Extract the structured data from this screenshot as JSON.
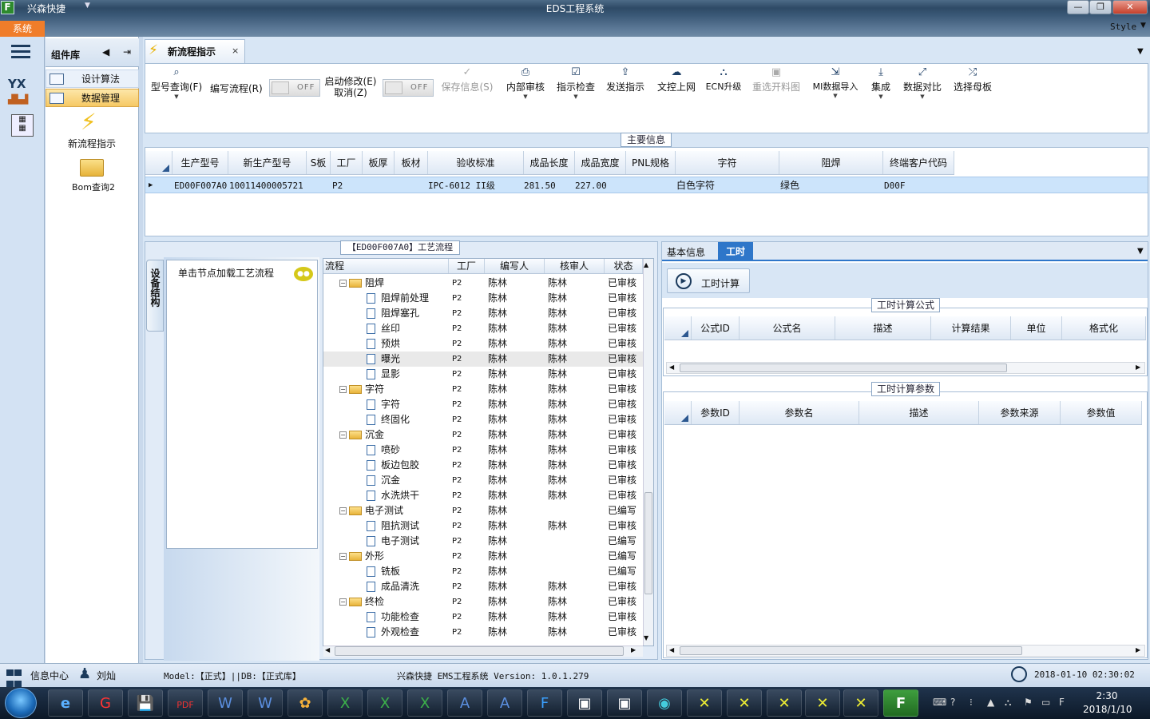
{
  "window": {
    "quick_title": "兴森快捷",
    "title": "EDS工程系统",
    "buttons": {
      "minimize": "—",
      "restore": "❐",
      "close": "✕"
    }
  },
  "ribbon": {
    "system_tab": "系统",
    "style_label": "Style"
  },
  "component_panel": {
    "title": "组件库",
    "items": [
      {
        "label": "设计算法",
        "icon": "form-icon"
      },
      {
        "label": "数据管理",
        "icon": "form-icon",
        "selected": true
      }
    ],
    "shortcuts": [
      {
        "label": "新流程指示",
        "icon": "lightning-icon"
      },
      {
        "label": "Bom查询2",
        "icon": "folder-icon"
      }
    ]
  },
  "doc_tab": {
    "label": "新流程指示",
    "close": "×"
  },
  "toolbar": {
    "query": "型号查询(F)",
    "write_flow": "编写流程(R)",
    "write_flow_toggle": "OFF",
    "start_modify": "启动修改(E)",
    "cancel": "取消(Z)",
    "start_modify_toggle": "OFF",
    "save": "保存信息(S)",
    "internal_review": "内部审核",
    "instruction_check": "指示检查",
    "send_instruction": "发送指示",
    "upload": "文控上网",
    "ecn_upgrade": "ECN升级",
    "reselect_cutting": "重选开料图",
    "mi_import": "MI数据导入",
    "integrate": "集成",
    "compare": "数据对比",
    "select_master": "选择母板"
  },
  "main_info": {
    "title": "主要信息",
    "columns": [
      "生产型号",
      "新生产型号",
      "S板",
      "工厂",
      "板厚",
      "板材",
      "验收标准",
      "成品长度",
      "成品宽度",
      "PNL规格",
      "字符",
      "阻焊",
      "终端客户代码"
    ],
    "row": [
      "ED00F007A0",
      "10011400005721",
      "",
      "P2",
      "",
      "",
      "IPC-6012 II级",
      "281.50",
      "227.00",
      "",
      "白色字符",
      "绿色",
      "D00F"
    ]
  },
  "process": {
    "title": "【ED00F007A0】工艺流程",
    "side_tab": "设备结构",
    "hint": "单击节点加载工艺流程",
    "columns": [
      "流程",
      "工厂",
      "编写人",
      "核审人",
      "状态"
    ],
    "rows": [
      {
        "name": "阻焊",
        "level": 0,
        "factory": "P2",
        "writer": "陈林",
        "reviewer": "陈林",
        "status": "已审核"
      },
      {
        "name": "阻焊前处理",
        "level": 1,
        "factory": "P2",
        "writer": "陈林",
        "reviewer": "陈林",
        "status": "已审核"
      },
      {
        "name": "阻焊塞孔",
        "level": 1,
        "factory": "P2",
        "writer": "陈林",
        "reviewer": "陈林",
        "status": "已审核"
      },
      {
        "name": "丝印",
        "level": 1,
        "factory": "P2",
        "writer": "陈林",
        "reviewer": "陈林",
        "status": "已审核"
      },
      {
        "name": "预烘",
        "level": 1,
        "factory": "P2",
        "writer": "陈林",
        "reviewer": "陈林",
        "status": "已审核"
      },
      {
        "name": "曝光",
        "level": 1,
        "factory": "P2",
        "writer": "陈林",
        "reviewer": "陈林",
        "status": "已审核",
        "highlight": true
      },
      {
        "name": "显影",
        "level": 1,
        "factory": "P2",
        "writer": "陈林",
        "reviewer": "陈林",
        "status": "已审核"
      },
      {
        "name": "字符",
        "level": 0,
        "factory": "P2",
        "writer": "陈林",
        "reviewer": "陈林",
        "status": "已审核"
      },
      {
        "name": "字符",
        "level": 1,
        "factory": "P2",
        "writer": "陈林",
        "reviewer": "陈林",
        "status": "已审核"
      },
      {
        "name": "终固化",
        "level": 1,
        "factory": "P2",
        "writer": "陈林",
        "reviewer": "陈林",
        "status": "已审核"
      },
      {
        "name": "沉金",
        "level": 0,
        "factory": "P2",
        "writer": "陈林",
        "reviewer": "陈林",
        "status": "已审核"
      },
      {
        "name": "喷砂",
        "level": 1,
        "factory": "P2",
        "writer": "陈林",
        "reviewer": "陈林",
        "status": "已审核"
      },
      {
        "name": "板边包胶",
        "level": 1,
        "factory": "P2",
        "writer": "陈林",
        "reviewer": "陈林",
        "status": "已审核"
      },
      {
        "name": "沉金",
        "level": 1,
        "factory": "P2",
        "writer": "陈林",
        "reviewer": "陈林",
        "status": "已审核"
      },
      {
        "name": "水洗烘干",
        "level": 1,
        "factory": "P2",
        "writer": "陈林",
        "reviewer": "陈林",
        "status": "已审核"
      },
      {
        "name": "电子测试",
        "level": 0,
        "factory": "P2",
        "writer": "陈林",
        "reviewer": "",
        "status": "已编写"
      },
      {
        "name": "阻抗测试",
        "level": 1,
        "factory": "P2",
        "writer": "陈林",
        "reviewer": "陈林",
        "status": "已审核"
      },
      {
        "name": "电子测试",
        "level": 1,
        "factory": "P2",
        "writer": "陈林",
        "reviewer": "",
        "status": "已编写"
      },
      {
        "name": "外形",
        "level": 0,
        "factory": "P2",
        "writer": "陈林",
        "reviewer": "",
        "status": "已编写"
      },
      {
        "name": "铣板",
        "level": 1,
        "factory": "P2",
        "writer": "陈林",
        "reviewer": "",
        "status": "已编写"
      },
      {
        "name": "成品清洗",
        "level": 1,
        "factory": "P2",
        "writer": "陈林",
        "reviewer": "陈林",
        "status": "已审核"
      },
      {
        "name": "终检",
        "level": 0,
        "factory": "P2",
        "writer": "陈林",
        "reviewer": "陈林",
        "status": "已审核"
      },
      {
        "name": "功能检查",
        "level": 1,
        "factory": "P2",
        "writer": "陈林",
        "reviewer": "陈林",
        "status": "已审核"
      },
      {
        "name": "外观检查",
        "level": 1,
        "factory": "P2",
        "writer": "陈林",
        "reviewer": "陈林",
        "status": "已审核"
      }
    ]
  },
  "right_panel": {
    "tabs": [
      "基本信息",
      "工时"
    ],
    "calc_button": "工时计算",
    "formula": {
      "title": "工时计算公式",
      "columns": [
        "公式ID",
        "公式名",
        "描述",
        "计算结果",
        "单位",
        "格式化"
      ]
    },
    "params": {
      "title": "工时计算参数",
      "columns": [
        "参数ID",
        "参数名",
        "描述",
        "参数来源",
        "参数值"
      ]
    }
  },
  "status": {
    "info_center": "信息中心",
    "user": "刘灿",
    "model": "Model:【正式】||DB:【正式库】",
    "app": "兴森快捷 EMS工程系统 Version: 1.0.1.279",
    "datetime": "2018-01-10 02:30:02"
  },
  "taskbar": {
    "time": "2:30",
    "date": "2018/1/10"
  },
  "colors": {
    "accent": "#2e76c9",
    "system_tab": "#f07d2a",
    "selected_row": "#cce4fb"
  }
}
